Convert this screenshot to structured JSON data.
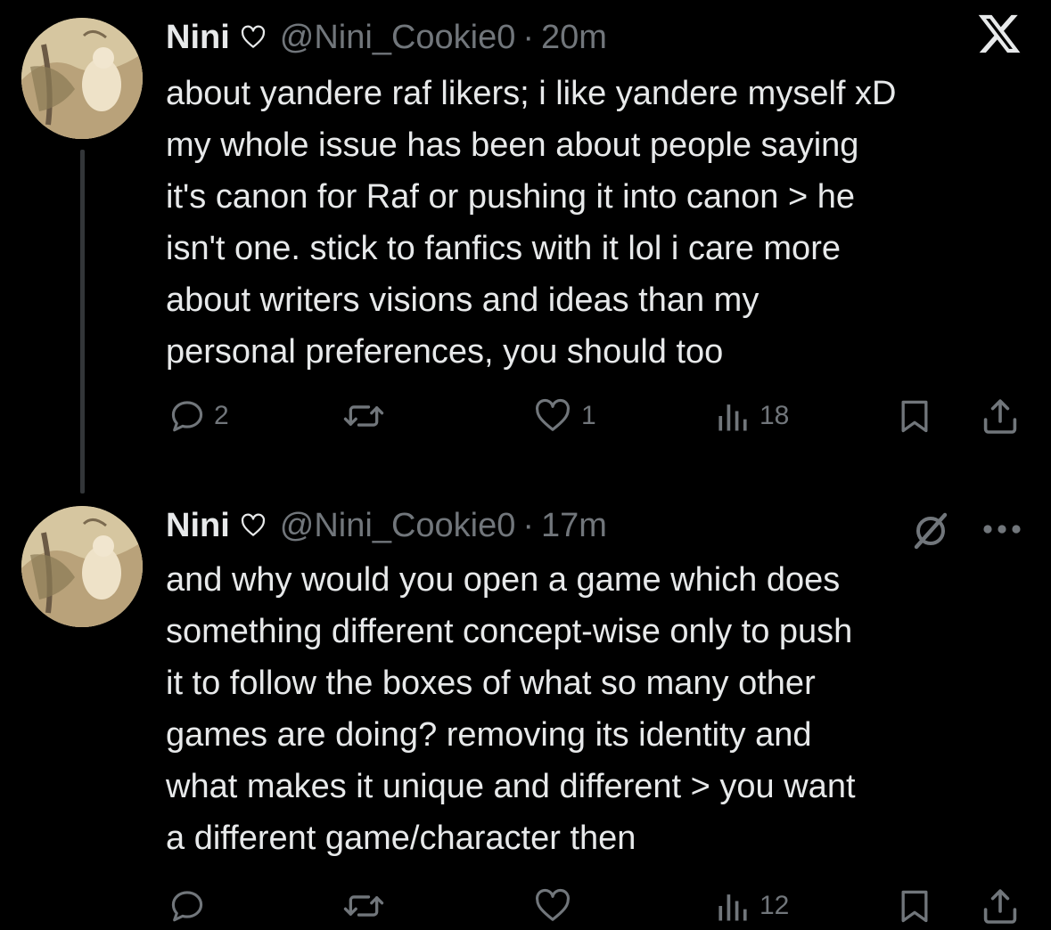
{
  "brand": {
    "logo": "x-logo",
    "accent": "#e7e9ea",
    "muted": "#71767b",
    "background": "#000000"
  },
  "tweets": [
    {
      "display_name": "Nini",
      "name_badge": "heart-outline-icon",
      "handle": "@Nini_Cookie0",
      "separator": "·",
      "time": "20m",
      "text": "about yandere raf likers; i like yandere myself xD\nmy whole issue has been about people saying\nit's canon for Raf or pushing it into canon > he\nisn't one. stick to fanfics with it lol i care more\nabout writers visions and ideas than my\npersonal preferences, you should too",
      "actions": {
        "replies": "2",
        "reposts": "",
        "likes": "1",
        "views": "18"
      }
    },
    {
      "display_name": "Nini",
      "name_badge": "heart-outline-icon",
      "handle": "@Nini_Cookie0",
      "separator": "·",
      "time": "17m",
      "text": "and why would you open a game which does\nsomething different concept-wise only to push\nit to follow the boxes of what so many other\ngames are doing? removing its identity and\nwhat makes it unique and different > you want\na different game/character then",
      "actions": {
        "replies": "",
        "reposts": "",
        "likes": "",
        "views": "12"
      }
    }
  ]
}
